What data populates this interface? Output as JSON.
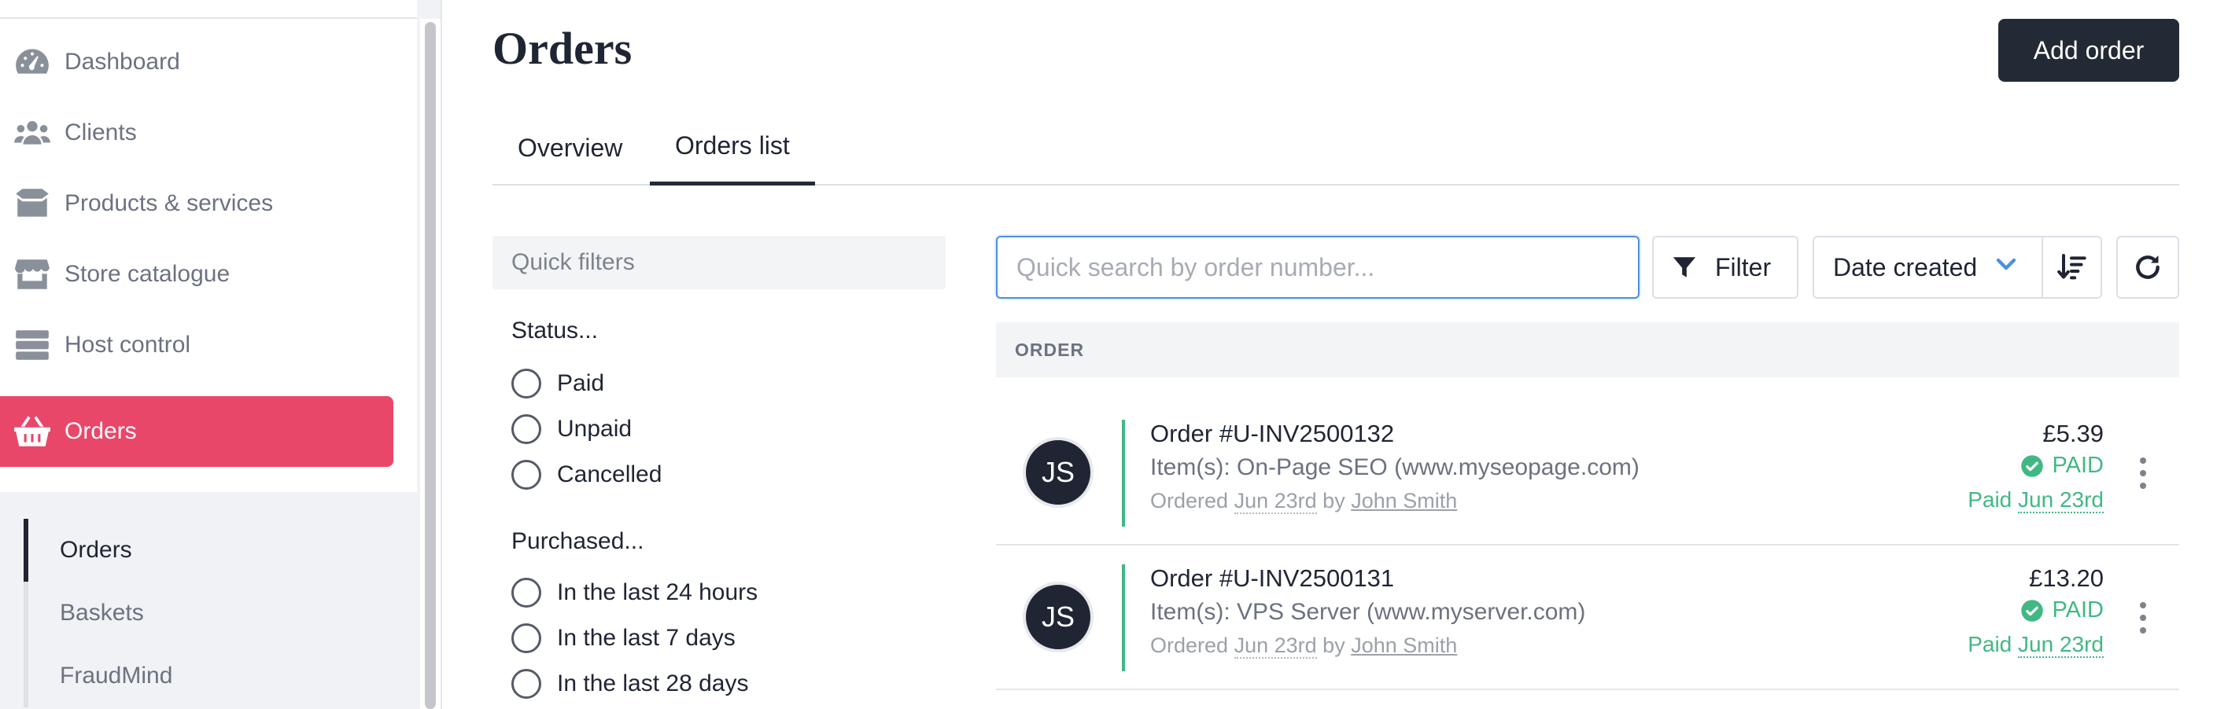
{
  "sidebar": {
    "nav": [
      {
        "label": "Dashboard",
        "icon": "dashboard-gauge-icon"
      },
      {
        "label": "Clients",
        "icon": "users-icon"
      },
      {
        "label": "Products & services",
        "icon": "box-icon"
      },
      {
        "label": "Store catalogue",
        "icon": "store-icon"
      },
      {
        "label": "Host control",
        "icon": "server-icon"
      },
      {
        "label": "Orders",
        "icon": "basket-icon",
        "active": true
      }
    ],
    "subnav": [
      {
        "label": "Orders",
        "active": true
      },
      {
        "label": "Baskets"
      },
      {
        "label": "FraudMind"
      }
    ]
  },
  "header": {
    "title": "Orders",
    "add_button": "Add order"
  },
  "tabs": [
    {
      "label": "Overview"
    },
    {
      "label": "Orders list",
      "active": true
    }
  ],
  "filters": {
    "header": "Quick filters",
    "status_heading": "Status...",
    "status_options": [
      "Paid",
      "Unpaid",
      "Cancelled"
    ],
    "purchased_heading": "Purchased...",
    "purchased_options": [
      "In the last 24 hours",
      "In the last 7 days",
      "In the last 28 days"
    ]
  },
  "toolbar": {
    "search_placeholder": "Quick search by order number...",
    "filter_label": "Filter",
    "sort_label": "Date created",
    "icons": {
      "filter": "funnel-icon",
      "sort_chevron": "chevron-down-icon",
      "sort_direction": "sort-descending-icon",
      "refresh": "refresh-icon"
    }
  },
  "table": {
    "column_header": "ORDER",
    "orders": [
      {
        "initials": "JS",
        "title": "Order #U-INV2500132",
        "items": "Item(s): On-Page SEO (www.myseopage.com)",
        "ordered_prefix": "Ordered",
        "ordered_date": "Jun 23rd",
        "by_text": "by",
        "customer": "John Smith",
        "amount": "£5.39",
        "status": "PAID",
        "paid_prefix": "Paid",
        "paid_date": "Jun 23rd"
      },
      {
        "initials": "JS",
        "title": "Order #U-INV2500131",
        "items": "Item(s): VPS Server (www.myserver.com)",
        "ordered_prefix": "Ordered",
        "ordered_date": "Jun 23rd",
        "by_text": "by",
        "customer": "John Smith",
        "amount": "£13.20",
        "status": "PAID",
        "paid_prefix": "Paid",
        "paid_date": "Jun 23rd"
      }
    ]
  },
  "colors": {
    "accent": "#e9476a",
    "dark": "#222a35",
    "paid_green": "#41b883",
    "focus_blue": "#4a90e2"
  }
}
